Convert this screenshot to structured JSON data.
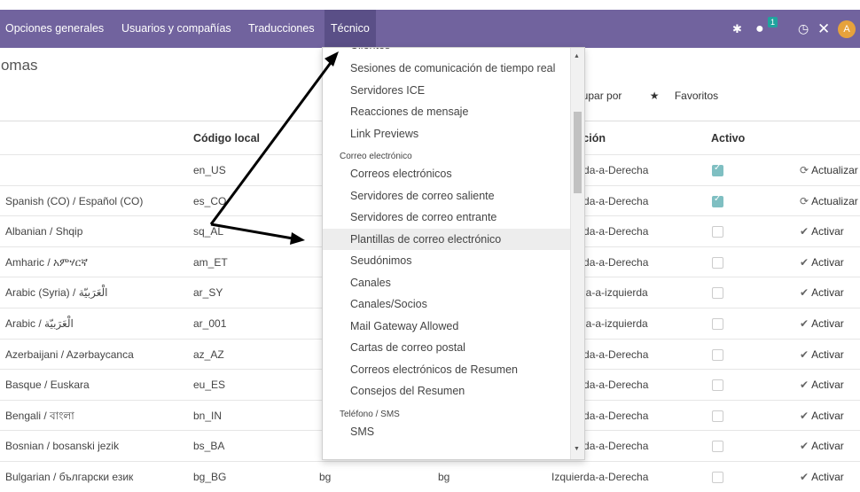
{
  "navbar": {
    "items": [
      "Opciones generales",
      "Usuarios y compañías",
      "Traducciones",
      "Técnico"
    ],
    "chat_badge": "1",
    "avatar_letter": "A",
    "bg_color": "#71639e"
  },
  "page": {
    "title": "Idiomas",
    "filters": [
      "Agrupar por",
      "Favoritos"
    ]
  },
  "table": {
    "headers": [
      "Código local",
      "Dirección",
      "Activo"
    ],
    "rows": [
      {
        "name": "",
        "code": "en_US",
        "iso": "",
        "iso2": "",
        "direction": "Izquierda-a-Derecha",
        "active": true,
        "action": "Actualizar"
      },
      {
        "name": "Spanish (CO) / Español (CO)",
        "code": "es_CO",
        "iso": "",
        "iso2": "",
        "direction": "Izquierda-a-Derecha",
        "active": true,
        "action": "Actualizar"
      },
      {
        "name": "Albanian / Shqip",
        "code": "sq_AL",
        "iso": "",
        "iso2": "",
        "direction": "Izquierda-a-Derecha",
        "active": false,
        "action": "Activar"
      },
      {
        "name": "Amharic / አምሃርኛ",
        "code": "am_ET",
        "iso": "",
        "iso2": "",
        "direction": "Izquierda-a-Derecha",
        "active": false,
        "action": "Activar"
      },
      {
        "name": "Arabic (Syria) / الْعَرَبيّة",
        "code": "ar_SY",
        "iso": "",
        "iso2": "",
        "direction": "Derecha-a-izquierda",
        "active": false,
        "action": "Activar"
      },
      {
        "name": "Arabic / الْعَرَبيّة",
        "code": "ar_001",
        "iso": "",
        "iso2": "",
        "direction": "Derecha-a-izquierda",
        "active": false,
        "action": "Activar"
      },
      {
        "name": "Azerbaijani / Azərbaycanca",
        "code": "az_AZ",
        "iso": "",
        "iso2": "",
        "direction": "Izquierda-a-Derecha",
        "active": false,
        "action": "Activar"
      },
      {
        "name": "Basque / Euskara",
        "code": "eu_ES",
        "iso": "",
        "iso2": "",
        "direction": "Izquierda-a-Derecha",
        "active": false,
        "action": "Activar"
      },
      {
        "name": "Bengali / বাংলা",
        "code": "bn_IN",
        "iso": "",
        "iso2": "",
        "direction": "Izquierda-a-Derecha",
        "active": false,
        "action": "Activar"
      },
      {
        "name": "Bosnian / bosanski jezik",
        "code": "bs_BA",
        "iso": "",
        "iso2": "",
        "direction": "Izquierda-a-Derecha",
        "active": false,
        "action": "Activar"
      },
      {
        "name": "Bulgarian / български език",
        "code": "bg_BG",
        "iso": "bg",
        "iso2": "bg",
        "direction": "Izquierda-a-Derecha",
        "active": false,
        "action": "Activar"
      }
    ]
  },
  "dropdown": {
    "top_cut": "Clientes",
    "group1": [
      "Sesiones de comunicación de tiempo real",
      "Servidores ICE",
      "Reacciones de mensaje",
      "Link Previews"
    ],
    "header_email": "Correo electrónico",
    "group2": [
      "Correos electrónicos",
      "Servidores de correo saliente",
      "Servidores de correo entrante",
      "Plantillas de correo electrónico",
      "Seudónimos",
      "Canales",
      "Canales/Socios",
      "Mail Gateway Allowed",
      "Cartas de correo postal",
      "Correos electrónicos de Resumen",
      "Consejos del Resumen"
    ],
    "header_phone": "Teléfono / SMS",
    "group3": [
      "SMS"
    ],
    "highlighted": "Plantillas de correo electrónico"
  }
}
